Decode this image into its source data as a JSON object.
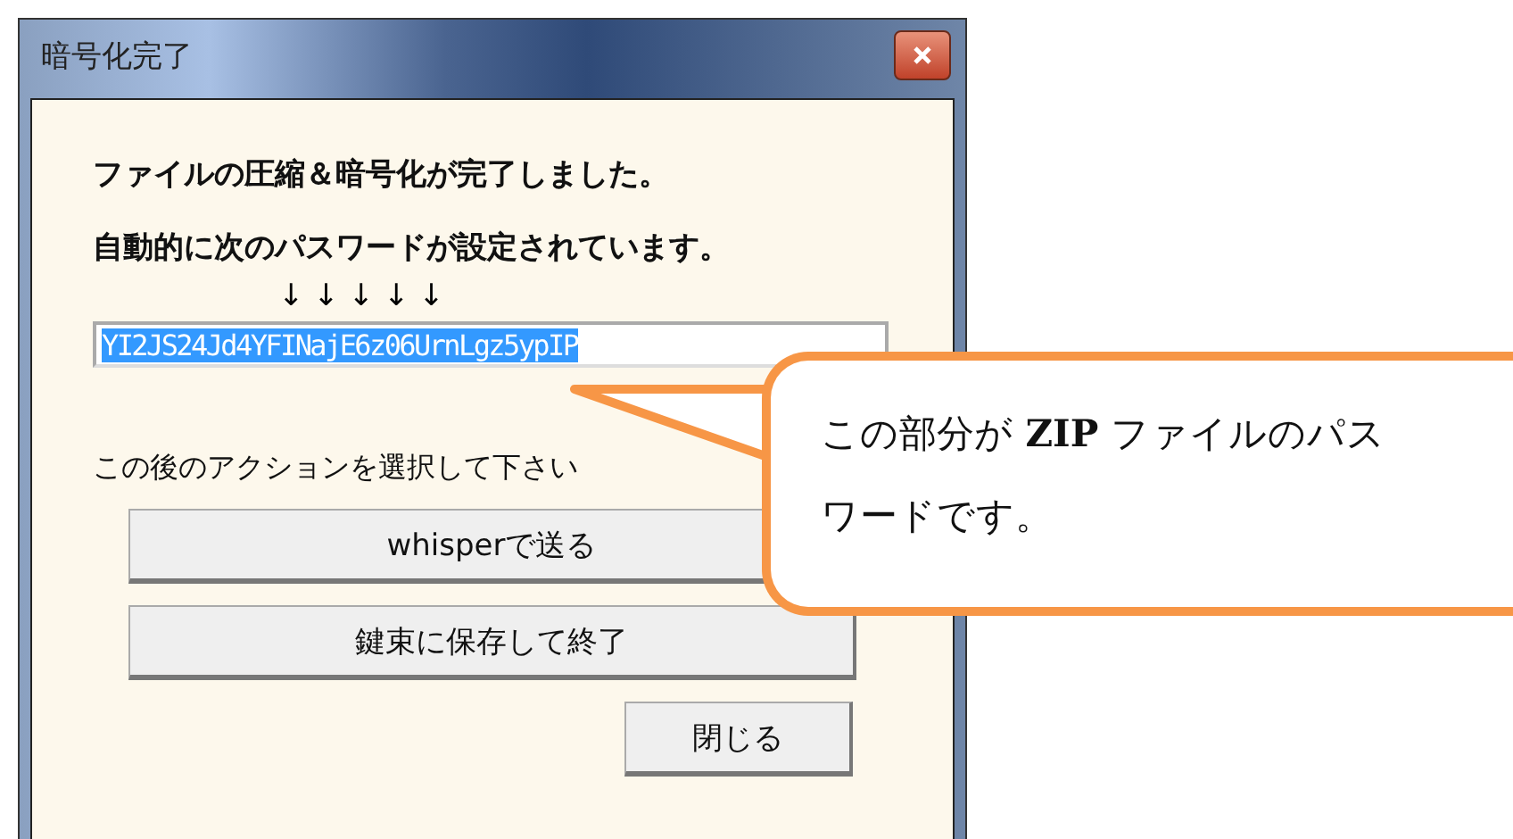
{
  "window": {
    "title": "暗号化完了"
  },
  "messages": [
    "ファイルの圧縮＆暗号化が完了しました。",
    "自動的に次のパスワードが設定されています。"
  ],
  "arrows": "↓ ↓ ↓ ↓ ↓",
  "password_field": {
    "value": "YI2JS24Jd4YFINajE6z06UrnLgz5ypIP",
    "selected": true
  },
  "prompt": "この後のアクションを選択して下さい",
  "action_buttons": [
    "whisperで送る",
    "鍵束に保存して終了"
  ],
  "close_button": "閉じる",
  "callout": {
    "text": "この部分が **ZIP** ファイルのパスワードです。"
  }
}
